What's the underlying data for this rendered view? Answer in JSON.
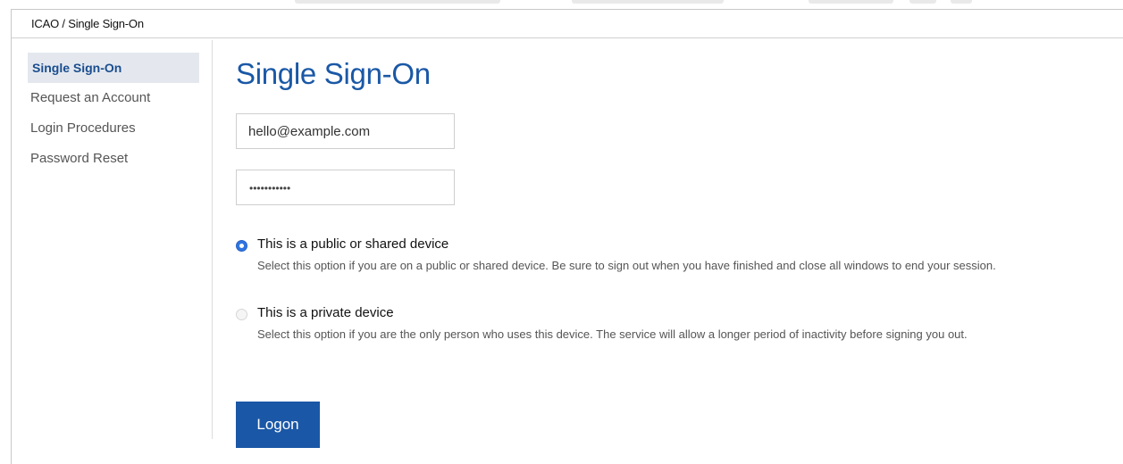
{
  "breadcrumb": "ICAO / Single Sign-On",
  "sidebar": {
    "items": [
      {
        "label": "Single Sign-On",
        "active": true
      },
      {
        "label": "Request an Account",
        "active": false
      },
      {
        "label": "Login Procedures",
        "active": false
      },
      {
        "label": "Password Reset",
        "active": false
      }
    ]
  },
  "main": {
    "title": "Single Sign-On",
    "email": {
      "value": "hello@example.com"
    },
    "password": {
      "masked_value": "•••••••••••"
    },
    "device_options": [
      {
        "label": "This is a public or shared device",
        "description": "Select this option if you are on a public or shared device. Be sure to sign out when you have finished and close all windows to end your session.",
        "selected": true
      },
      {
        "label": "This is a private device",
        "description": "Select this option if you are the only person who uses this device. The service will allow a longer period of inactivity before signing you out.",
        "selected": false
      }
    ],
    "logon_label": "Logon"
  },
  "colors": {
    "accent": "#1a57a6",
    "title": "#1a58a6",
    "sidebar_active_bg": "#e4e8ee",
    "radio_selected": "#2f74e0"
  }
}
